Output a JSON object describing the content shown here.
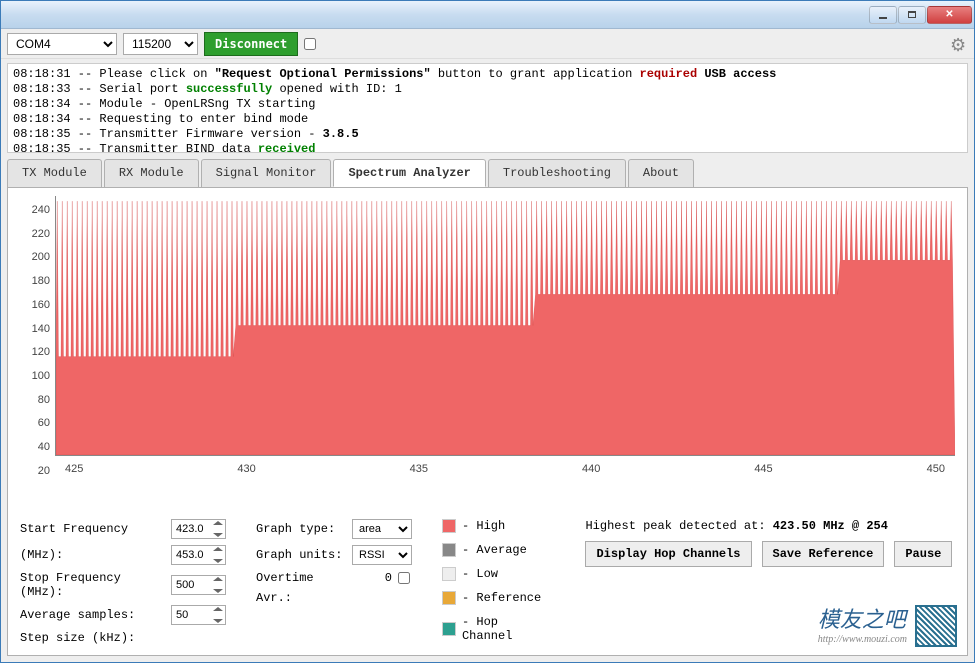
{
  "window": {
    "min_tip": "Minimize",
    "max_tip": "Maximize",
    "close_tip": "Close"
  },
  "toolbar": {
    "port": "COM4",
    "baud": "115200",
    "disconnect": "Disconnect"
  },
  "log": [
    {
      "time": "08:18:31",
      "pre": "Please click on ",
      "quote": "\"Request Optional Permissions\"",
      "post": " button to grant application ",
      "red": "required",
      "tail": " USB access",
      "bold_tail": true,
      "tail2": ""
    },
    {
      "time": "08:18:33",
      "pre": "Serial port ",
      "green": "successfully",
      "post": " opened with ID: 1"
    },
    {
      "time": "08:18:34",
      "pre": "Module - OpenLRSng TX starting"
    },
    {
      "time": "08:18:34",
      "pre": "Requesting to enter bind mode"
    },
    {
      "time": "08:18:35",
      "pre": "Transmitter Firmware version - ",
      "bold": "3.8.5"
    },
    {
      "time": "08:18:35",
      "pre": "Transmitter BIND data ",
      "green": "received"
    }
  ],
  "tabs": {
    "tx": "TX Module",
    "rx": "RX Module",
    "sig": "Signal Monitor",
    "spec": "Spectrum Analyzer",
    "trouble": "Troubleshooting",
    "about": "About"
  },
  "chart_data": {
    "type": "area",
    "xlabel": "",
    "ylabel": "",
    "xlim": [
      423,
      453
    ],
    "ylim": [
      0,
      250
    ],
    "y_ticks": [
      "240",
      "220",
      "200",
      "180",
      "160",
      "140",
      "120",
      "100",
      "80",
      "60",
      "40",
      "20"
    ],
    "x_ticks": [
      "425",
      "430",
      "435",
      "440",
      "445",
      "450"
    ],
    "series": [
      {
        "name": "High",
        "color": "#ef6666"
      }
    ],
    "peaks": 254,
    "note": "Dense comb of spikes reaching ~245 across band; baseline steps up: ~95 (423-429), ~125 (429-439), ~155 (439-449), ~188 (449-453)"
  },
  "controls": {
    "start_freq_label": "Start Frequency (MHz):",
    "start_freq": "423.0",
    "mhz_label": "(MHz):",
    "mhz_val": "453.0",
    "stop_freq_label": "Stop Frequency (MHz):",
    "stop_freq": "500",
    "avg_label": "Average samples:",
    "avg": "50",
    "step_label": "Step size (kHz):",
    "gtype_label": "Graph type:",
    "gtype": "area",
    "gunits_label": "Graph units:",
    "gunits": "RSSI",
    "overtime_label": "Overtime",
    "overtime": "0",
    "avr_label": "Avr.:"
  },
  "legend": {
    "high": "- High",
    "avg": "- Average",
    "low": "- Low",
    "ref": "- Reference",
    "hop": "- Hop Channel"
  },
  "peak": {
    "label": "Highest peak detected at: ",
    "value": "423.50 MHz @ 254"
  },
  "buttons": {
    "hop": "Display Hop Channels",
    "save": "Save Reference",
    "pause": "Pause"
  },
  "branding": {
    "logo": "模友之吧",
    "url": "http://www.mouzi.com"
  }
}
